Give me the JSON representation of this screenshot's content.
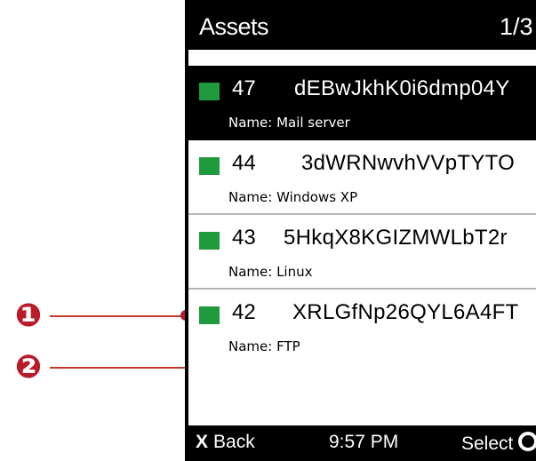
{
  "screen": {
    "title": "Assets",
    "page_indicator": "1/3"
  },
  "assets": [
    {
      "number": "47",
      "id": "dEBwJkhK0i6dmp04Y",
      "name_label": "Name: Mail server",
      "status_color": "#1f9a3c",
      "selected": true
    },
    {
      "number": "44",
      "id": "3dWRNwvhVVpTYTO",
      "name_label": "Name: Windows XP",
      "status_color": "#1f9a3c",
      "selected": false
    },
    {
      "number": "43",
      "id": "5HkqX8KGIZMWLbT2r",
      "name_label": "Name: Linux",
      "status_color": "#1f9a3c",
      "selected": false
    },
    {
      "number": "42",
      "id": "XRLGfNp26QYL6A4FT",
      "name_label": "Name: FTP",
      "status_color": "#1f9a3c",
      "selected": false
    }
  ],
  "softkeys": {
    "left_icon": "x-mark-icon",
    "left_glyph": "X",
    "left_label": "Back",
    "clock": "9:57 PM",
    "right_label": "Select",
    "right_icon": "ok-circle-icon"
  },
  "callouts": [
    {
      "label": "❶",
      "color": "#b81c2a"
    },
    {
      "label": "❷",
      "color": "#b81c2a"
    }
  ]
}
